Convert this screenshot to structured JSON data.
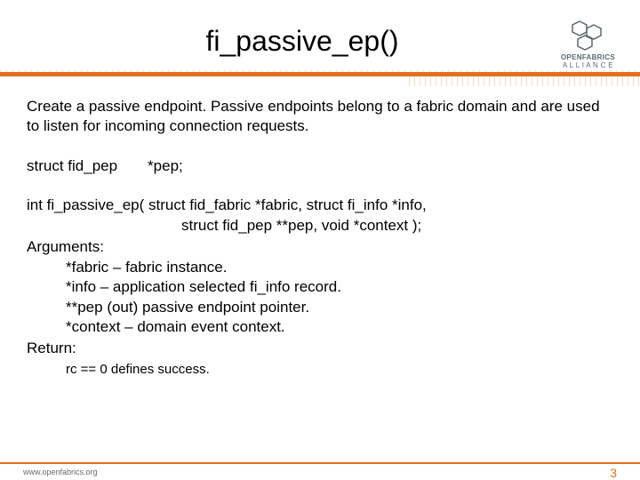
{
  "title": "fi_passive_ep()",
  "logo": {
    "line1": "OPENFABRICS",
    "line2": "A L L I A N C E"
  },
  "content": {
    "description": "Create a passive endpoint.  Passive endpoints belong to a fabric domain and are used to listen for incoming connection requests.",
    "declaration": "struct fid_pep  *pep;",
    "signature1": "int fi_passive_ep( struct fid_fabric *fabric, struct fi_info *info,",
    "signature2": "struct fid_pep **pep, void *context );",
    "arguments_heading": "Arguments:",
    "arguments": [
      "*fabric – fabric instance.",
      "*info – application selected fi_info record.",
      "**pep (out) passive endpoint pointer.",
      "*context – domain event context."
    ],
    "return_heading": "Return:",
    "return_text": "rc == 0 defines success."
  },
  "footer": {
    "url": "www.openfabrics.org",
    "page": "3"
  }
}
